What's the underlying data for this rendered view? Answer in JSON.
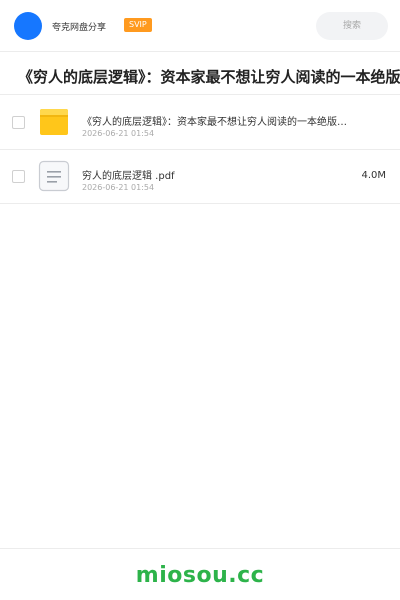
{
  "header": {
    "brand": "夸克网盘分享",
    "badge": "SVIP",
    "search_placeholder": "搜索",
    "accent_color": "#1677ff",
    "badge_color": "#ff9a1f"
  },
  "share": {
    "title": "《穷人的底层逻辑》：资本家最不想让穷人阅读的一本绝版"
  },
  "files": [
    {
      "name": "《穷人的底层逻辑》：资本家最不想让穷人阅读的一本绝版…",
      "date": "2026-06-21 01:54",
      "size": "",
      "icon": "folder-icon"
    },
    {
      "name": "穷人的底层逻辑 .pdf",
      "date": "2026-06-21 01:54",
      "size": "4.0M",
      "icon": "document-icon"
    }
  ],
  "footer": {
    "site": "miosou.cc",
    "color": "#2db34a"
  }
}
